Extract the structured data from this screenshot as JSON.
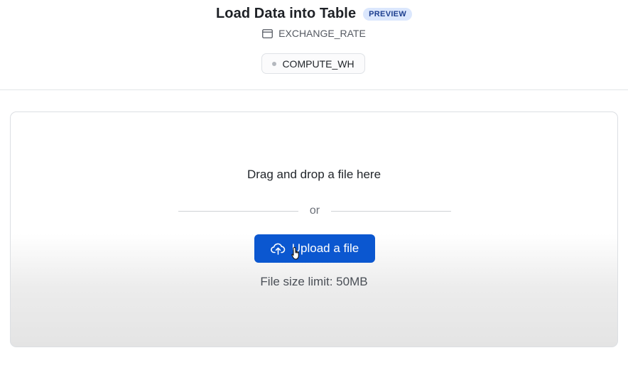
{
  "header": {
    "title": "Load Data into Table",
    "badge": "PREVIEW",
    "table_name": "EXCHANGE_RATE",
    "table_icon": "table-icon",
    "warehouse": "COMPUTE_WH"
  },
  "dropzone": {
    "drag_text": "Drag and drop a file here",
    "or_text": "or",
    "upload_label": "Upload a file",
    "upload_icon": "cloud-upload-icon",
    "size_limit": "File size limit: 50MB"
  },
  "colors": {
    "accent": "#0b57d0",
    "badge_bg": "#dbe7fd",
    "badge_text": "#1d3f8f"
  }
}
